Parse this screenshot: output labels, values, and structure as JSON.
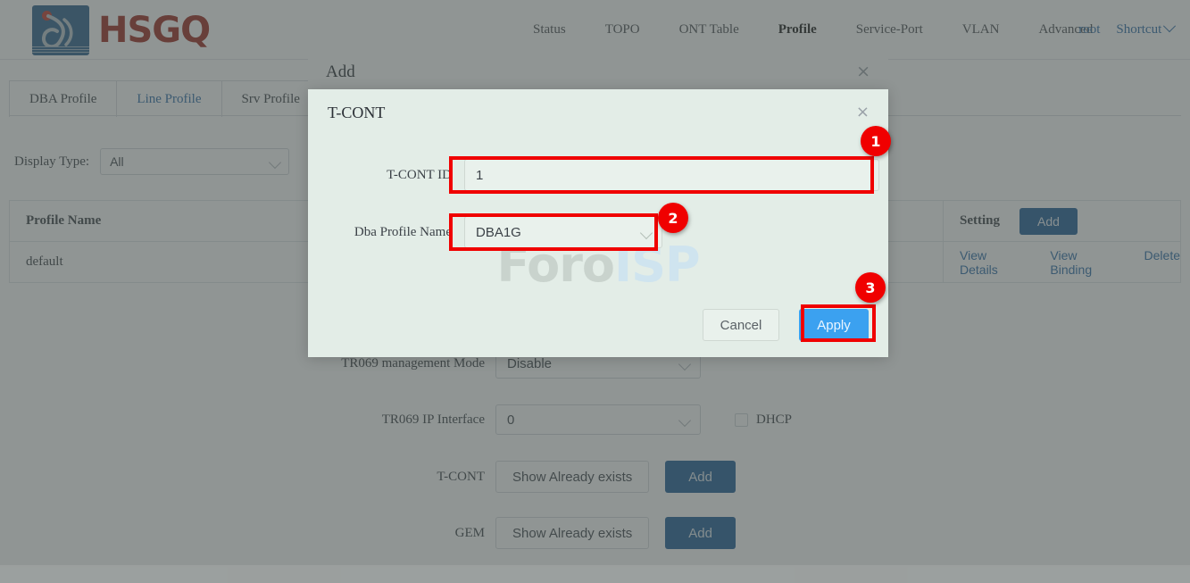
{
  "header": {
    "brand": "HSGQ",
    "nav_items": [
      {
        "label": "Status",
        "active": false
      },
      {
        "label": "TOPO",
        "active": false
      },
      {
        "label": "ONT Table",
        "active": false
      },
      {
        "label": "Profile",
        "active": true
      },
      {
        "label": "Service-Port",
        "active": false
      },
      {
        "label": "VLAN",
        "active": false
      },
      {
        "label": "Advanced",
        "active": false
      }
    ],
    "user": "root",
    "shortcut": "Shortcut"
  },
  "tabs": [
    {
      "label": "DBA Profile",
      "active": false
    },
    {
      "label": "Line Profile",
      "active": true
    },
    {
      "label": "Srv Profile",
      "active": false
    }
  ],
  "filter": {
    "label": "Display Type:",
    "value": "All"
  },
  "table": {
    "columns": [
      "Profile Name",
      "Setting"
    ],
    "header_action": "Add",
    "rows": [
      {
        "profile_name": "default",
        "actions": [
          "View Details",
          "View Binding",
          "Delete"
        ]
      }
    ]
  },
  "add_dialog": {
    "title": "Add",
    "close": "×",
    "fields": [
      {
        "label": "TR069 management Mode",
        "value": "Disable"
      },
      {
        "label": "TR069 IP Interface",
        "value": "0",
        "checkbox_label": "DHCP"
      },
      {
        "label": "T-CONT",
        "button": "Show Already exists",
        "add": "Add"
      },
      {
        "label": "GEM",
        "button": "Show Already exists",
        "add": "Add"
      }
    ]
  },
  "tcont_dialog": {
    "title": "T-CONT",
    "close": "×",
    "tcont_id_label": "T-CONT ID",
    "tcont_id_value": "1",
    "dba_label": "Dba Profile Name",
    "dba_value": "DBA1G",
    "cancel": "Cancel",
    "apply": "Apply"
  },
  "watermark": {
    "part1": "Foro",
    "part2": "ISP"
  },
  "annotations": [
    {
      "number": "1"
    },
    {
      "number": "2"
    },
    {
      "number": "3"
    }
  ],
  "colors": {
    "brand_red": "#9c2a20",
    "logo_blue": "#2c5f8d",
    "link_blue": "#2d6ca8",
    "button_blue": "#1f5e96",
    "apply_blue": "#3ba1f0",
    "annotation_red": "#f00000",
    "dialog_bg": "#e3ede7"
  }
}
